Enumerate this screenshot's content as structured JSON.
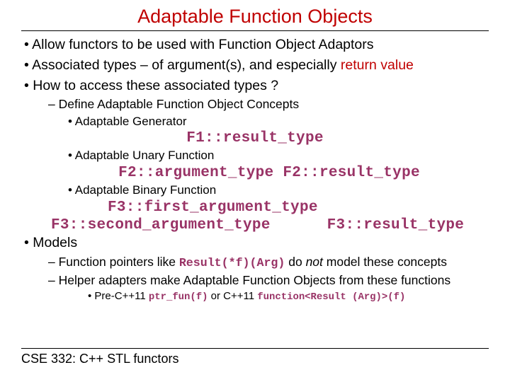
{
  "title": "Adaptable Function Objects",
  "bullets": {
    "b1": "Allow functors to be used with Function Object Adaptors",
    "b2_pre": "Associated types – of argument(s), and especially ",
    "b2_hl": "return value",
    "b3": "How to access these associated types ?",
    "b3_1": "Define Adaptable Function Object Concepts",
    "b3_1_a": "Adaptable Generator",
    "code_a": "F1::result_type",
    "b3_1_b": "Adaptable Unary Function",
    "code_b": "F2::argument_type  F2::result_type",
    "b3_1_c": "Adaptable Binary Function",
    "code_c1_left": "F3::first_argument_type",
    "code_c2_left": "F3::second_argument_type",
    "code_c2_right": "F3::result_type",
    "b4": "Models",
    "b4_1_pre": "Function pointers like ",
    "b4_1_code": "Result(*f)(Arg)",
    "b4_1_mid": " do ",
    "b4_1_ital": "not",
    "b4_1_post": " model these concepts",
    "b4_2": "Helper adapters make Adaptable Function Objects from these functions",
    "b4_2_a_pre": "Pre-C++11 ",
    "b4_2_a_code1": "ptr_fun(f)",
    "b4_2_a_mid": " or C++11 ",
    "b4_2_a_code2": "function<Result (Arg)>(f)"
  },
  "footer": "CSE 332: C++ STL functors"
}
